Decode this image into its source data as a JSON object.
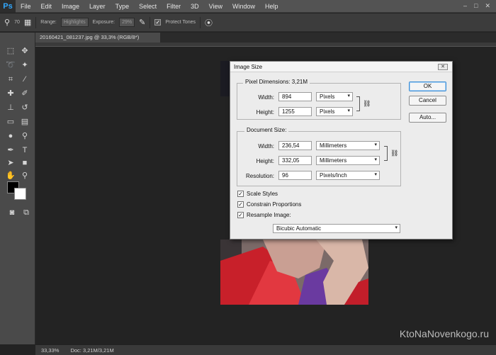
{
  "app": {
    "logo": "Ps",
    "menu": [
      "File",
      "Edit",
      "Image",
      "Layer",
      "Type",
      "Select",
      "Filter",
      "3D",
      "View",
      "Window",
      "Help"
    ]
  },
  "options_bar": {
    "brush_size": "70",
    "range_label": "Range:",
    "range_value": "Highlights",
    "exposure_label": "Exposure:",
    "exposure_value": "29%",
    "protect_tones_label": "Protect Tones"
  },
  "document": {
    "tab_title": "20160421_081237.jpg @ 33,3% (RGB/8*)"
  },
  "status_bar": {
    "zoom": "33,33%",
    "doc_info": "Doc: 3,21M/3,21M"
  },
  "watermark": "KtoNaNovenkogo.ru",
  "dialog": {
    "title": "Image Size",
    "pixel_dimensions": {
      "title": "Pixel Dimensions: 3,21M",
      "width_label": "Width:",
      "width_value": "894",
      "width_unit": "Pixels",
      "height_label": "Height:",
      "height_value": "1255",
      "height_unit": "Pixels"
    },
    "document_size": {
      "title": "Document Size:",
      "width_label": "Width:",
      "width_value": "236,54",
      "width_unit": "Millimeters",
      "height_label": "Height:",
      "height_value": "332,05",
      "height_unit": "Millimeters",
      "resolution_label": "Resolution:",
      "resolution_value": "96",
      "resolution_unit": "Pixels/Inch"
    },
    "options": {
      "scale_styles": "Scale Styles",
      "constrain_proportions": "Constrain Proportions",
      "resample_image": "Resample Image:",
      "resample_method": "Bicubic Automatic"
    },
    "buttons": {
      "ok": "OK",
      "cancel": "Cancel",
      "auto": "Auto..."
    }
  }
}
